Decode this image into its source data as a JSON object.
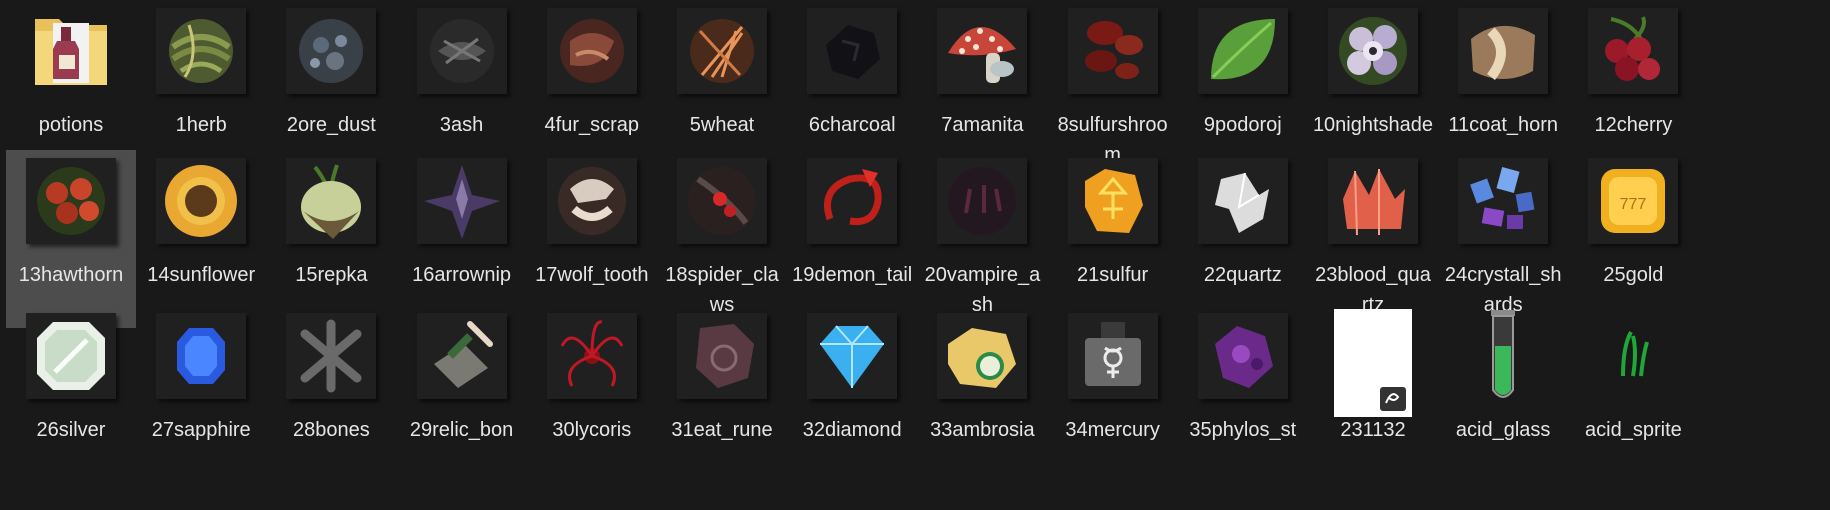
{
  "files": [
    {
      "label": "potions",
      "icon": "folder-icon",
      "selected": false
    },
    {
      "label": "1herb",
      "icon": "herb-icon",
      "selected": false
    },
    {
      "label": "2ore_dust",
      "icon": "ore-dust-icon",
      "selected": false
    },
    {
      "label": "3ash",
      "icon": "ash-icon",
      "selected": false
    },
    {
      "label": "4fur_scrap",
      "icon": "fur-scrap-icon",
      "selected": false
    },
    {
      "label": "5wheat",
      "icon": "wheat-icon",
      "selected": false
    },
    {
      "label": "6charcoal",
      "icon": "charcoal-icon",
      "selected": false
    },
    {
      "label": "7amanita",
      "icon": "amanita-icon",
      "selected": false
    },
    {
      "label": "8sulfurshroom",
      "icon": "sulfurshroom-icon",
      "selected": false
    },
    {
      "label": "9podoroj",
      "icon": "leaf-icon",
      "selected": false
    },
    {
      "label": "10nightshade",
      "icon": "nightshade-icon",
      "selected": false
    },
    {
      "label": "11coat_horn",
      "icon": "coat-horn-icon",
      "selected": false
    },
    {
      "label": "12cherry",
      "icon": "cherry-icon",
      "selected": false
    },
    {
      "label": "13hawthorn",
      "icon": "hawthorn-icon",
      "selected": true
    },
    {
      "label": "14sunflower",
      "icon": "sunflower-icon",
      "selected": false
    },
    {
      "label": "15repka",
      "icon": "turnip-icon",
      "selected": false
    },
    {
      "label": "16arrownip",
      "icon": "arrownip-icon",
      "selected": false
    },
    {
      "label": "17wolf_tooth",
      "icon": "wolf-tooth-icon",
      "selected": false
    },
    {
      "label": "18spider_claws",
      "icon": "spider-claws-icon",
      "selected": false
    },
    {
      "label": "19demon_tail",
      "icon": "demon-tail-icon",
      "selected": false
    },
    {
      "label": "20vampire_ash",
      "icon": "vampire-ash-icon",
      "selected": false
    },
    {
      "label": "21sulfur",
      "icon": "sulfur-icon",
      "selected": false
    },
    {
      "label": "22quartz",
      "icon": "quartz-icon",
      "selected": false
    },
    {
      "label": "23blood_quartz",
      "icon": "blood-quartz-icon",
      "selected": false
    },
    {
      "label": "24crystall_shards",
      "icon": "crystal-shards-icon",
      "selected": false
    },
    {
      "label": "25gold",
      "icon": "gold-coin-icon",
      "selected": false
    },
    {
      "label": "26silver",
      "icon": "silver-icon",
      "selected": false
    },
    {
      "label": "27sapphire",
      "icon": "sapphire-icon",
      "selected": false
    },
    {
      "label": "28bones",
      "icon": "bones-icon",
      "selected": false
    },
    {
      "label": "29relic_bon",
      "icon": "relic-bone-icon",
      "selected": false
    },
    {
      "label": "30lycoris",
      "icon": "lycoris-icon",
      "selected": false
    },
    {
      "label": "31eat_rune",
      "icon": "rune-icon",
      "selected": false
    },
    {
      "label": "32diamond",
      "icon": "diamond-icon",
      "selected": false
    },
    {
      "label": "33ambrosia",
      "icon": "ambrosia-icon",
      "selected": false
    },
    {
      "label": "34mercury",
      "icon": "mercury-icon",
      "selected": false
    },
    {
      "label": "35phylos_st",
      "icon": "phylos-stone-icon",
      "selected": false
    },
    {
      "label": "231132",
      "icon": "white-image-icon",
      "selected": false
    },
    {
      "label": "acid_glass",
      "icon": "test-tube-icon",
      "selected": false
    },
    {
      "label": "acid_sprite",
      "icon": "acid-sprite-icon",
      "selected": false
    }
  ]
}
